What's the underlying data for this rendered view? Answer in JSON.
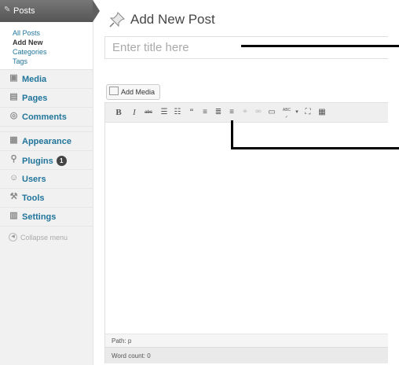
{
  "sidebar": {
    "posts": {
      "label": "Posts",
      "icon": "pin-icon"
    },
    "submenu": [
      {
        "label": "All Posts"
      },
      {
        "label": "Add New"
      },
      {
        "label": "Categories"
      },
      {
        "label": "Tags"
      }
    ],
    "items": [
      {
        "label": "Media",
        "icon": "media-icon"
      },
      {
        "label": "Pages",
        "icon": "pages-icon"
      },
      {
        "label": "Comments",
        "icon": "comments-icon"
      },
      {
        "label": "Appearance",
        "icon": "appearance-icon"
      },
      {
        "label": "Plugins",
        "icon": "plugins-icon",
        "badge": "1"
      },
      {
        "label": "Users",
        "icon": "users-icon"
      },
      {
        "label": "Tools",
        "icon": "tools-icon"
      },
      {
        "label": "Settings",
        "icon": "settings-icon"
      }
    ],
    "collapse_label": "Collapse menu"
  },
  "main": {
    "title": "Add New Post",
    "title_placeholder": "Enter title here",
    "add_media_label": "Add Media",
    "toolbar": {
      "bold": "B",
      "italic": "I",
      "strike": "abc",
      "quote": "“",
      "spell": "ABC"
    },
    "path_label": "Path: p",
    "word_count_label": "Word count: 0"
  },
  "colors": {
    "link": "#21759b",
    "menu_active": "#555555",
    "sidebar_bg": "#f1f1f1"
  }
}
